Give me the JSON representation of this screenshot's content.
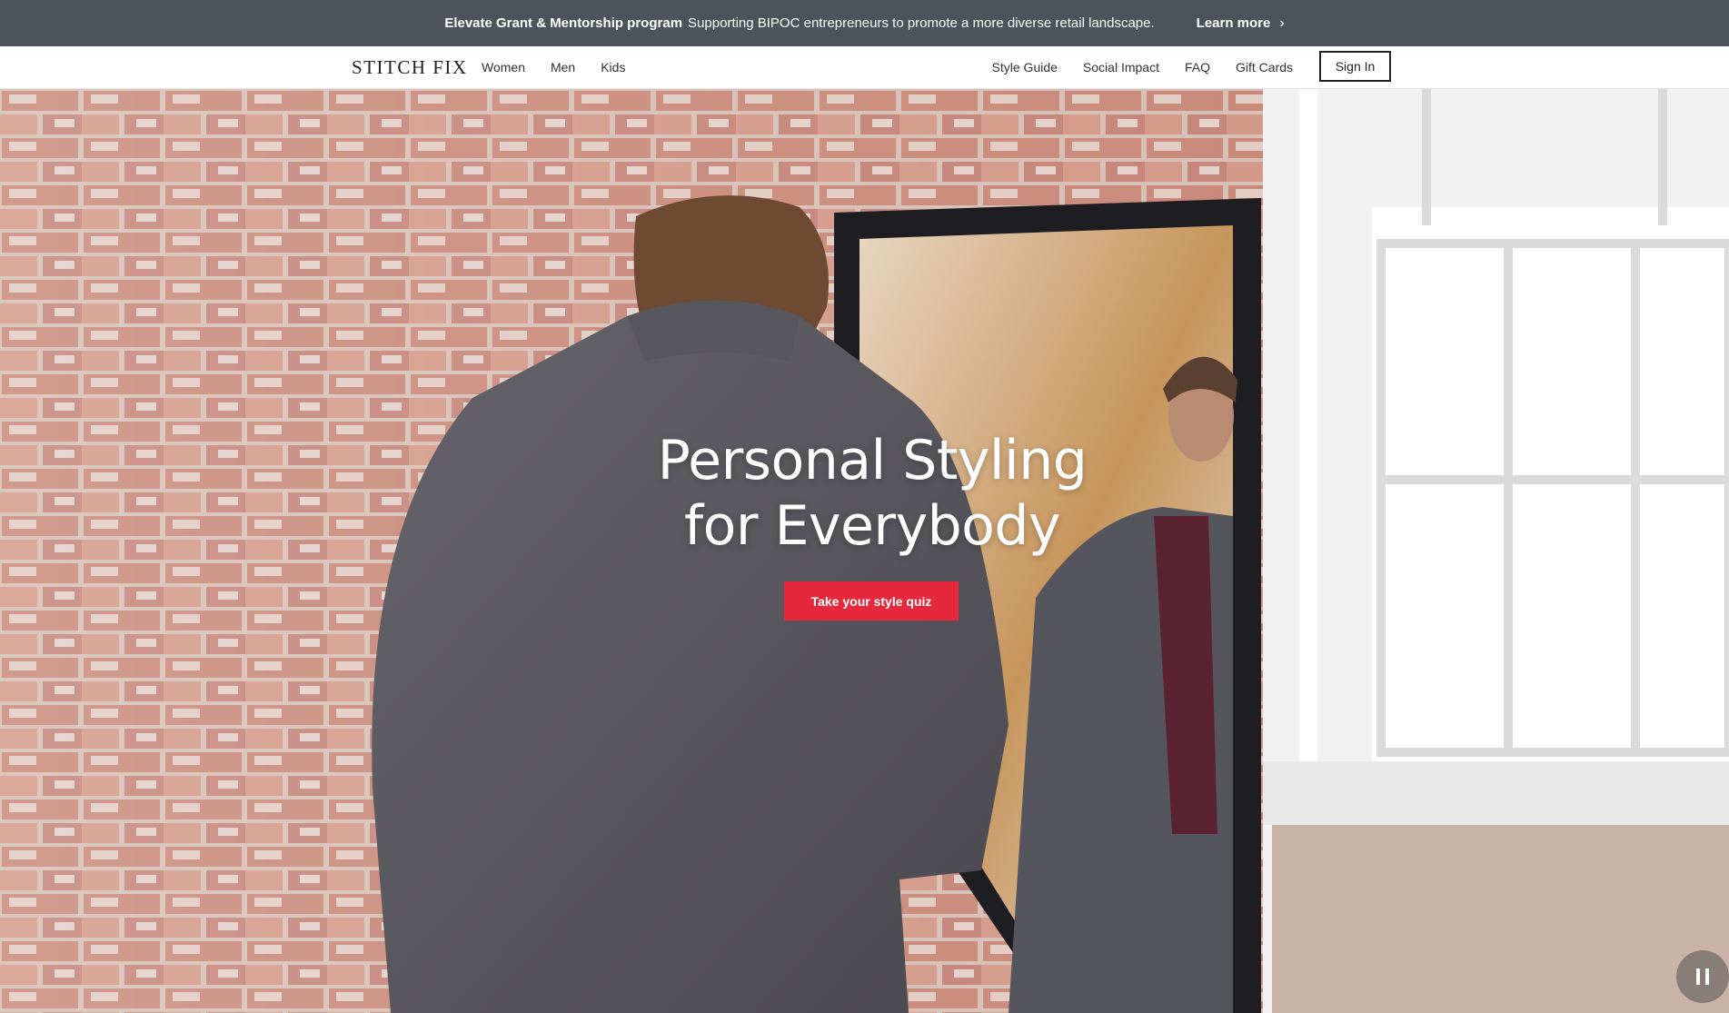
{
  "promo": {
    "title": "Elevate Grant & Mentorship program",
    "text": "Supporting BIPOC entrepreneurs to promote a more diverse retail landscape.",
    "link_label": "Learn more",
    "link_icon": "chevron-right-icon"
  },
  "nav": {
    "brand": "STITCH FIX",
    "left_items": [
      "Women",
      "Men",
      "Kids"
    ],
    "right_items": [
      "Style Guide",
      "Social Impact",
      "FAQ",
      "Gift Cards"
    ],
    "signin_label": "Sign In"
  },
  "hero": {
    "headline_line1": "Personal Styling",
    "headline_line2": "for Everybody",
    "cta_label": "Take your style quiz",
    "pause_icon": "pause-icon"
  },
  "colors": {
    "banner_bg": "#4e525c",
    "cta_red": "#e5283c",
    "text_dark": "#222222"
  }
}
